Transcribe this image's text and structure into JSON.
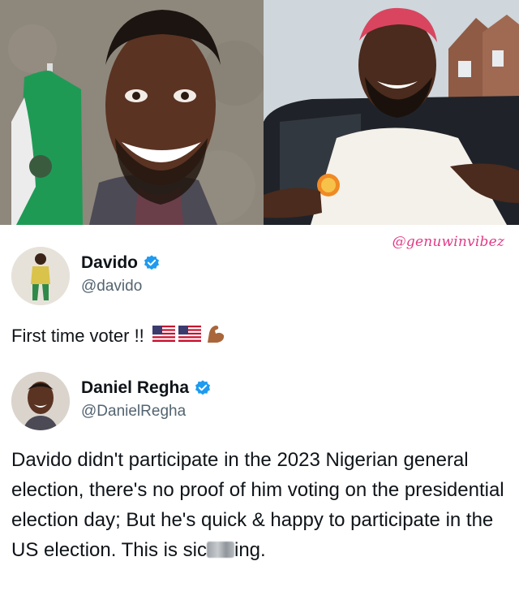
{
  "watermark": "@genuwinvibez",
  "tweet1": {
    "display_name": "Davido",
    "handle": "@davido",
    "text": "First time voter !!",
    "emojis": [
      "us-flag-emoji",
      "us-flag-emoji",
      "flexed-biceps-emoji"
    ]
  },
  "tweet2": {
    "display_name": "Daniel Regha",
    "handle": "@DanielRegha",
    "text_before_blur": "Davido didn't participate in the 2023 Nigerian general election, there's no proof of him voting on the presidential election day;  But he's quick & happy to participate in the US election. This is sic",
    "text_after_blur": "ing."
  },
  "colors": {
    "verified_badge": "#1d9bf0",
    "watermark": "#e23a86",
    "handle_gray": "#536471",
    "text": "#0f1419"
  }
}
